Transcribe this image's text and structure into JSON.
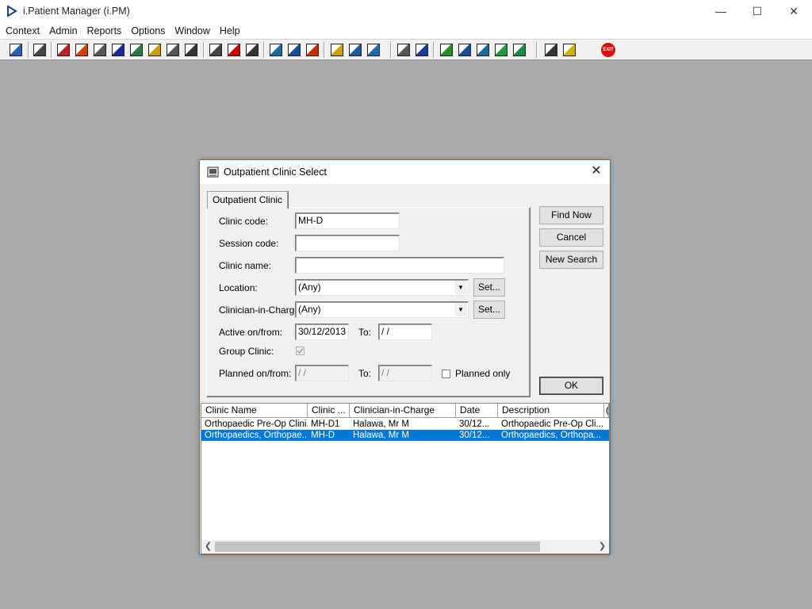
{
  "app": {
    "title": "i.Patient Manager (i.PM)",
    "minimize_glyph": "—",
    "maximize_glyph": "☐",
    "close_glyph": "✕"
  },
  "menu": [
    "Context",
    "Admin",
    "Reports",
    "Options",
    "Window",
    "Help"
  ],
  "toolbar": {
    "icons": [
      "patient-icon",
      "printer-icon",
      "book-icon",
      "edit-icon",
      "id-card-icon",
      "m-icon",
      "doctor-icon",
      "notes-icon",
      "referral-icon",
      "transfer-icon",
      "search-doc-icon",
      "clock-icon",
      "monitor-icon",
      "screen-icon",
      "window-icon",
      "dial-icon",
      "note-icon",
      "bed-icon",
      "person-bed-icon",
      "document-icon",
      "bar-chart-icon",
      "globe-icon",
      "check-list-icon",
      "check-down-icon",
      "green-arrow-icon",
      "refresh-icon",
      "swap-icon",
      "warning-icon",
      "exit-icon"
    ],
    "exit_label": "EXIT"
  },
  "dialog": {
    "title": "Outpatient Clinic Select",
    "close_glyph": "✕",
    "tab_label": "Outpatient Clinic",
    "fields": {
      "clinic_code_label": "Clinic code:",
      "clinic_code_value": "MH-D",
      "session_code_label": "Session code:",
      "session_code_value": "",
      "clinic_name_label": "Clinic name:",
      "clinic_name_value": "",
      "location_label": "Location:",
      "location_value": "(Any)",
      "clinician_label": "Clinician-in-Charge:",
      "clinician_value": "(Any)",
      "set_label": "Set...",
      "active_label": "Active on/from:",
      "active_from_value": "30/12/2013",
      "to_label": "To:",
      "active_to_value": " /  /",
      "group_clinic_label": "Group Clinic:",
      "planned_label": "Planned on/from:",
      "planned_from_value": " /  /",
      "planned_to_value": " /  /",
      "planned_only_label": "Planned only"
    },
    "buttons": {
      "find_now": "Find Now",
      "cancel": "Cancel",
      "new_search": "New Search",
      "ok": "OK"
    },
    "results": {
      "columns": [
        "Clinic Name",
        "Clinic ...",
        "Clinician-in-Charge",
        "Date",
        "Description",
        "("
      ],
      "rows": [
        [
          "Orthopaedic Pre-Op Clini...",
          "MH-D1",
          "Halawa, Mr M",
          "30/12...",
          "Orthopaedic Pre-Op Cli..."
        ],
        [
          "Orthopaedics, Orthopae...",
          "MH-D",
          "Halawa, Mr M",
          "30/12...",
          "Orthopaedics, Orthopa..."
        ]
      ],
      "selected_row": 1
    }
  },
  "colors": {
    "desktop": "#ababab",
    "selection": "#0078d7",
    "dialog_border": "#1883d7"
  }
}
